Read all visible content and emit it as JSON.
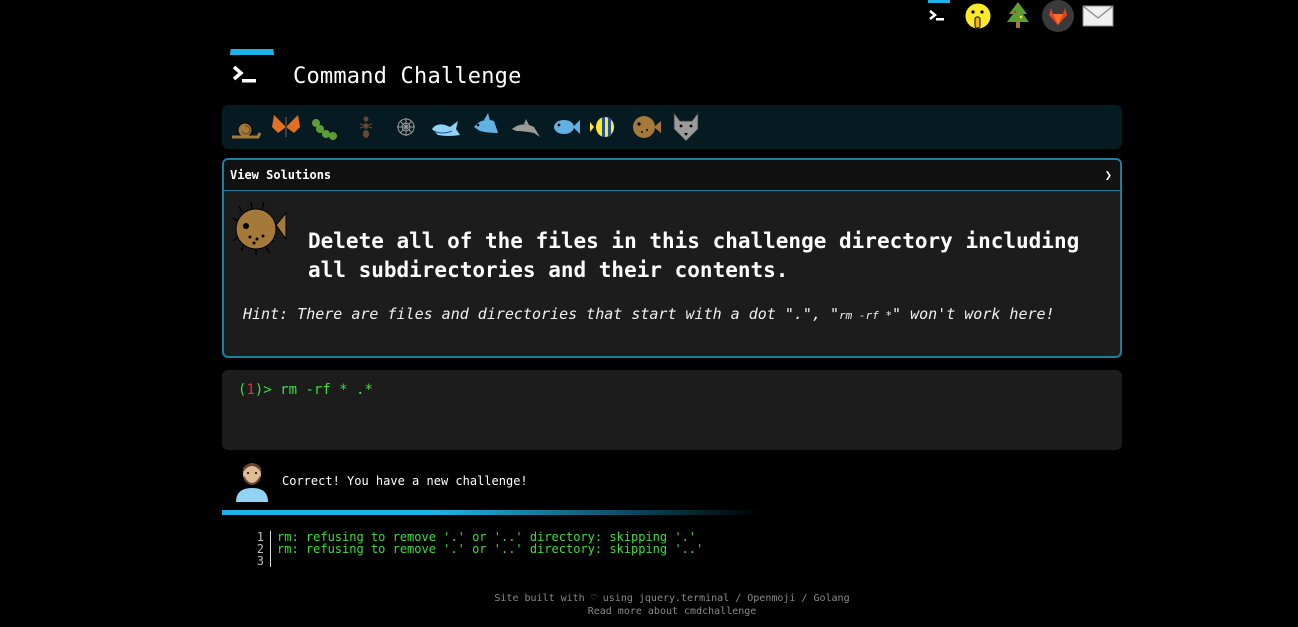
{
  "header": {
    "title": "Command Challenge"
  },
  "top_icons": [
    {
      "name": "terminal-icon"
    },
    {
      "name": "shushing-face-icon"
    },
    {
      "name": "christmas-tree-icon"
    },
    {
      "name": "gitlab-icon"
    },
    {
      "name": "envelope-icon"
    }
  ],
  "levels": [
    {
      "name": "snail-icon"
    },
    {
      "name": "butterfly-icon"
    },
    {
      "name": "caterpillar-icon"
    },
    {
      "name": "ant-icon"
    },
    {
      "name": "spider-web-icon"
    },
    {
      "name": "whale-icon"
    },
    {
      "name": "shark-icon"
    },
    {
      "name": "dolphin-icon"
    },
    {
      "name": "fish-icon"
    },
    {
      "name": "tropical-fish-icon"
    },
    {
      "name": "blowfish-icon"
    },
    {
      "name": "wolf-icon"
    }
  ],
  "challenge": {
    "solutions_label": "View Solutions",
    "solutions_chevron": "❯",
    "icon": "blowfish-icon",
    "text": "Delete all of the files in this challenge directory including all subdirectories and their contents.",
    "hint_prefix": "Hint: There are files and directories that start with a dot \".\", \"",
    "hint_code": "rm -rf *",
    "hint_suffix": "\" won't work here!"
  },
  "terminal": {
    "prompt_open": "(",
    "prompt_number": "1",
    "prompt_close": ")> ",
    "command": "rm -rf * .*"
  },
  "result": {
    "text": "Correct! You have a new challenge!"
  },
  "output": {
    "lines": [
      {
        "num": "1",
        "text": "rm: refusing to remove '.' or '..' directory: skipping '.'"
      },
      {
        "num": "2",
        "text": "rm: refusing to remove '.' or '..' directory: skipping '..'"
      },
      {
        "num": "3",
        "text": ""
      }
    ]
  },
  "footer": {
    "line1": "Site built with ♡ using jquery.terminal / Openmoji / Golang",
    "line2": "Read more about cmdchallenge"
  },
  "colors": {
    "accent": "#1eb3e6",
    "prompt_green": "#3fdc3f",
    "prompt_red": "#e03030",
    "border": "#1b7fa0"
  }
}
